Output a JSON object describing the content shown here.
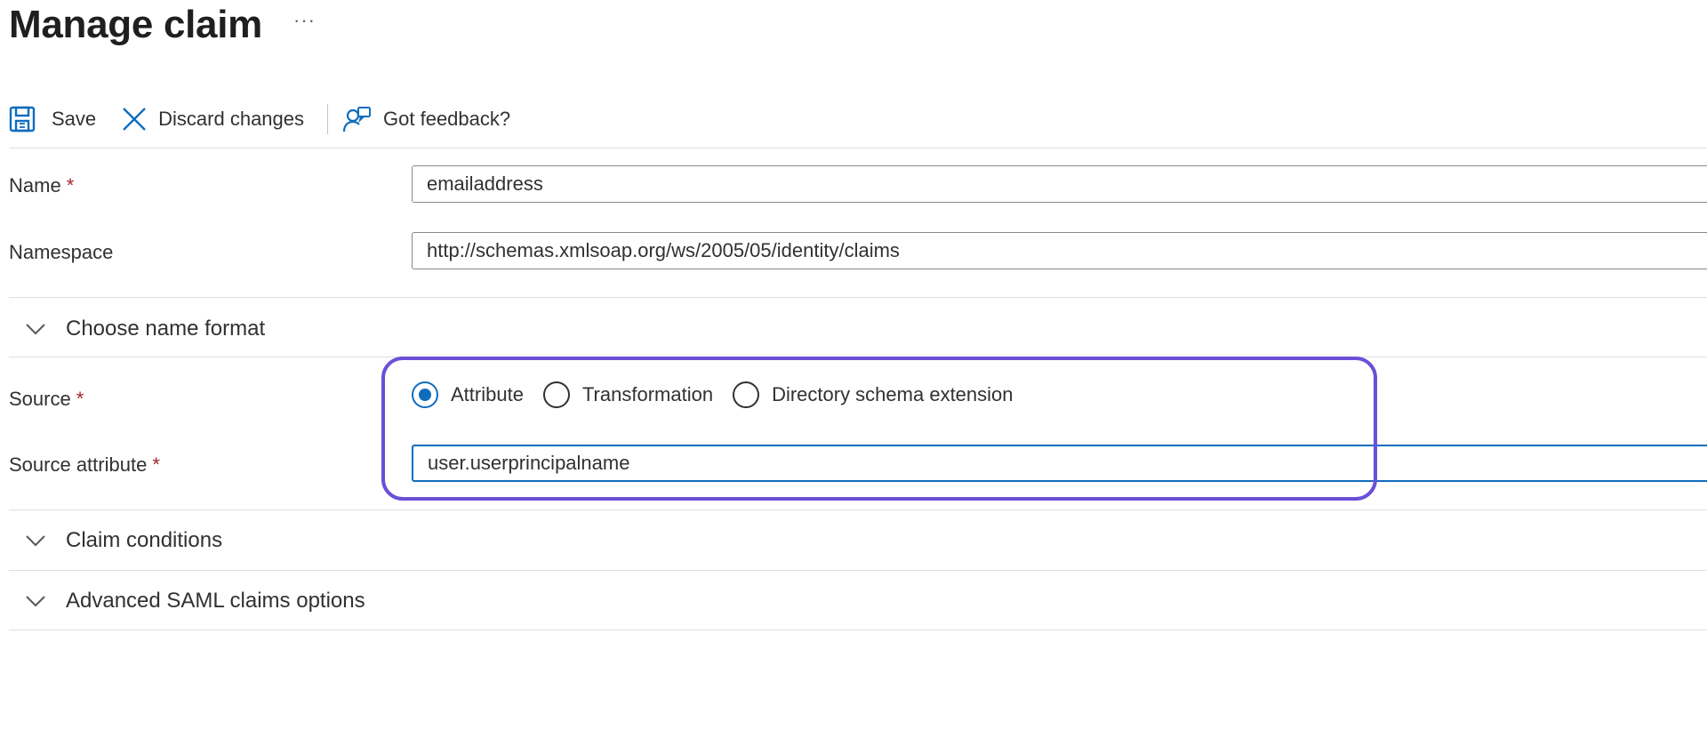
{
  "header": {
    "title": "Manage claim",
    "more_label": "···"
  },
  "toolbar": {
    "save_label": "Save",
    "discard_label": "Discard changes",
    "feedback_label": "Got feedback?"
  },
  "form": {
    "name": {
      "label": "Name",
      "required_mark": "*",
      "value": "emailaddress"
    },
    "namespace": {
      "label": "Namespace",
      "value": "http://schemas.xmlsoap.org/ws/2005/05/identity/claims"
    },
    "source": {
      "label": "Source",
      "required_mark": "*",
      "options": [
        "Attribute",
        "Transformation",
        "Directory schema extension"
      ],
      "selected": "Attribute"
    },
    "source_attribute": {
      "label": "Source attribute",
      "required_mark": "*",
      "value": "user.userprincipalname"
    }
  },
  "sections": {
    "name_format": "Choose name format",
    "claim_conditions": "Claim conditions",
    "advanced_saml": "Advanced SAML claims options"
  },
  "colors": {
    "accent": "#0f6cbd",
    "required": "#a4262c",
    "highlight_border": "#6b4fd8"
  },
  "icons": {
    "save": "save-icon",
    "discard": "close-icon",
    "feedback": "feedback-icon",
    "chevron": "chevron-down-icon"
  }
}
